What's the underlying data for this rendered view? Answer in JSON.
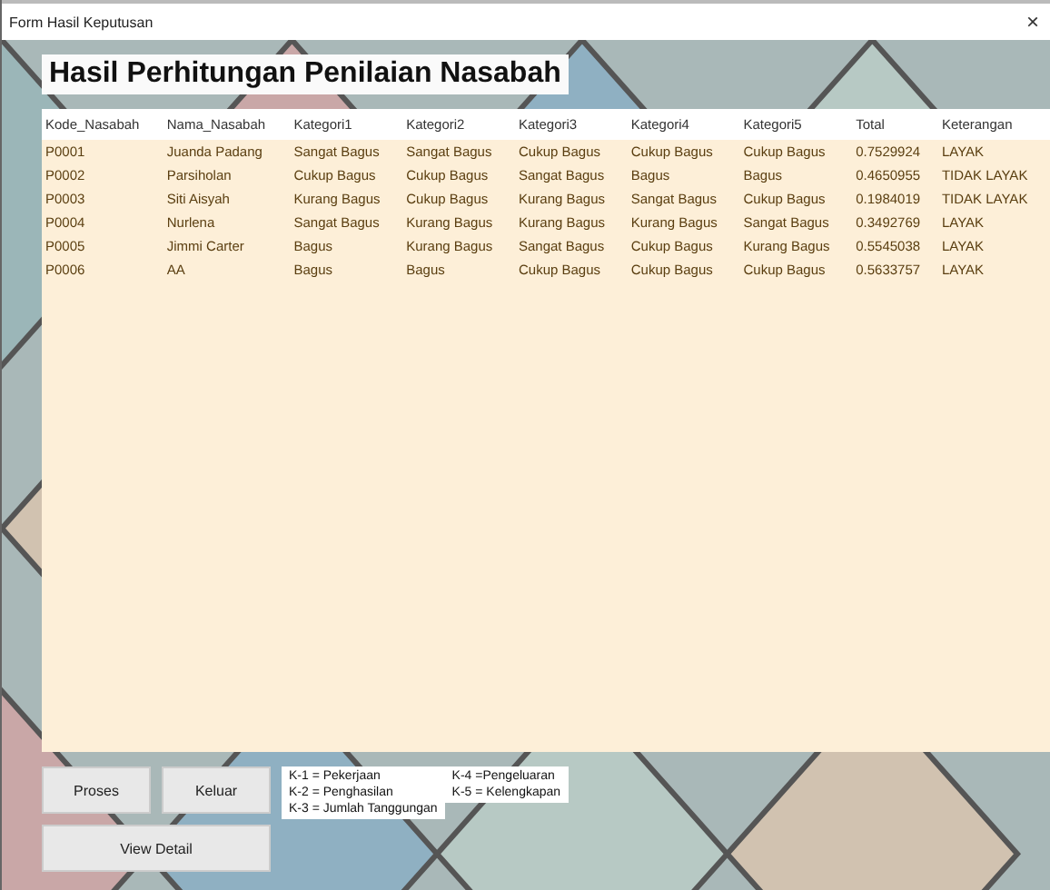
{
  "window": {
    "title": "Form Hasil Keputusan",
    "close": "×"
  },
  "heading": "Hasil Perhitungan Penilaian Nasabah",
  "table": {
    "columns": [
      "Kode_Nasabah",
      "Nama_Nasabah",
      "Kategori1",
      "Kategori2",
      "Kategori3",
      "Kategori4",
      "Kategori5",
      "Total",
      "Keterangan"
    ],
    "rows": [
      [
        "P0001",
        "Juanda Padang",
        "Sangat Bagus",
        "Sangat Bagus",
        "Cukup Bagus",
        "Cukup Bagus",
        "Cukup Bagus",
        "0.7529924",
        "LAYAK"
      ],
      [
        "P0002",
        "Parsiholan",
        "Cukup Bagus",
        "Cukup Bagus",
        "Sangat Bagus",
        "Bagus",
        "Bagus",
        "0.4650955",
        "TIDAK LAYAK"
      ],
      [
        "P0003",
        "Siti Aisyah",
        "Kurang Bagus",
        "Cukup Bagus",
        "Kurang Bagus",
        "Sangat Bagus",
        "Cukup Bagus",
        "0.1984019",
        "TIDAK LAYAK"
      ],
      [
        "P0004",
        "Nurlena",
        "Sangat Bagus",
        "Kurang Bagus",
        "Kurang Bagus",
        "Kurang Bagus",
        "Sangat Bagus",
        "0.3492769",
        "LAYAK"
      ],
      [
        "P0005",
        "Jimmi Carter",
        "Bagus",
        "Kurang Bagus",
        "Sangat Bagus",
        "Cukup Bagus",
        "Kurang Bagus",
        "0.5545038",
        "LAYAK"
      ],
      [
        "P0006",
        "AA",
        "Bagus",
        "Bagus",
        "Cukup Bagus",
        "Cukup Bagus",
        "Cukup Bagus",
        "0.5633757",
        "LAYAK"
      ]
    ]
  },
  "buttons": {
    "process": "Proses",
    "exit": "Keluar",
    "detail": "View Detail"
  },
  "legend": [
    [
      "K-1 = Pekerjaan",
      "K-2 = Penghasilan",
      "K-3 = Jumlah Tanggungan"
    ],
    [
      "K-4 =Pengeluaran",
      "K-5 = Kelengkapan"
    ]
  ]
}
